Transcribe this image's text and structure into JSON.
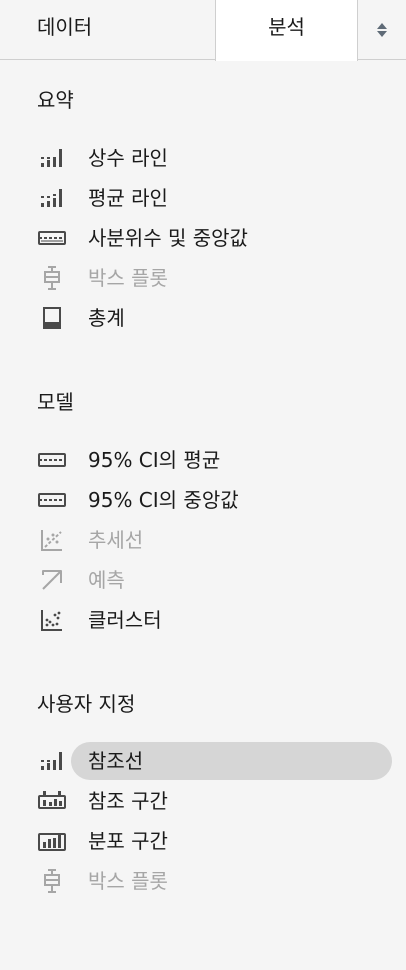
{
  "tabs": {
    "data_label": "데이터",
    "analysis_label": "분석"
  },
  "sections": {
    "summary": {
      "title": "요약",
      "items": [
        {
          "label": "상수 라인",
          "icon": "constant-line-icon",
          "enabled": true
        },
        {
          "label": "평균 라인",
          "icon": "average-line-icon",
          "enabled": true
        },
        {
          "label": "사분위수 및 중앙값",
          "icon": "quartile-band-icon",
          "enabled": true
        },
        {
          "label": "박스 플롯",
          "icon": "box-plot-icon",
          "enabled": false
        },
        {
          "label": "총계",
          "icon": "totals-icon",
          "enabled": true
        }
      ]
    },
    "model": {
      "title": "모델",
      "items": [
        {
          "label": "95% CI의 평균",
          "icon": "ci-mean-icon",
          "enabled": true
        },
        {
          "label": "95% CI의 중앙값",
          "icon": "ci-median-icon",
          "enabled": true
        },
        {
          "label": "추세선",
          "icon": "trend-line-icon",
          "enabled": false
        },
        {
          "label": "예측",
          "icon": "forecast-icon",
          "enabled": false
        },
        {
          "label": "클러스터",
          "icon": "cluster-icon",
          "enabled": true
        }
      ]
    },
    "custom": {
      "title": "사용자 지정",
      "items": [
        {
          "label": "참조선",
          "icon": "reference-line-icon",
          "enabled": true,
          "selected": true
        },
        {
          "label": "참조 구간",
          "icon": "reference-band-icon",
          "enabled": true
        },
        {
          "label": "분포 구간",
          "icon": "distribution-band-icon",
          "enabled": true
        },
        {
          "label": "박스 플롯",
          "icon": "box-plot-icon",
          "enabled": false
        }
      ]
    }
  },
  "colors": {
    "text": "#1a1a1a",
    "disabled": "#a6a6a6",
    "icon": "#4a4a4a",
    "selected_bg": "#d6d6d6",
    "panel_bg": "#f5f5f5"
  }
}
